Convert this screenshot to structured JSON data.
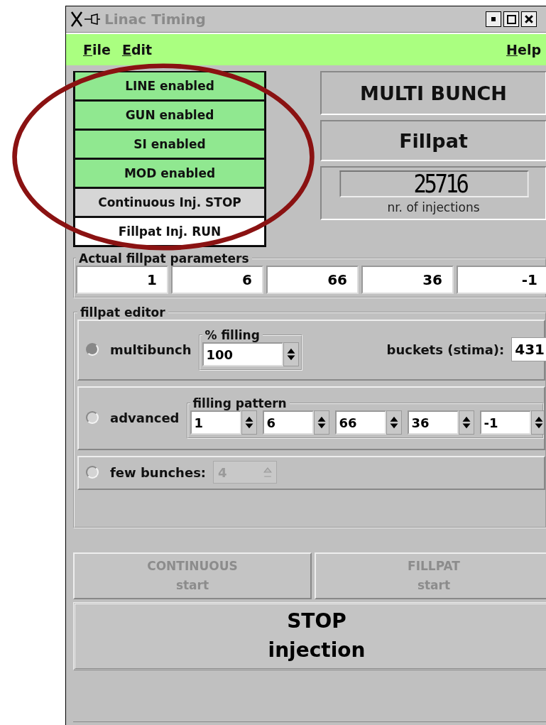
{
  "window": {
    "title": "Linac Timing"
  },
  "menu": {
    "left": [
      {
        "label": "File"
      },
      {
        "label": "Edit"
      }
    ],
    "right": [
      {
        "label": "Help"
      }
    ]
  },
  "status_buttons": [
    {
      "label": "LINE enabled",
      "kind": "enabled"
    },
    {
      "label": "GUN enabled",
      "kind": "enabled"
    },
    {
      "label": "SI enabled",
      "kind": "enabled"
    },
    {
      "label": "MOD enabled",
      "kind": "enabled"
    },
    {
      "label": "Continuous Inj. STOP",
      "kind": "stopped"
    },
    {
      "label": "Fillpat Inj. RUN",
      "kind": "running"
    }
  ],
  "mode": "MULTI BUNCH",
  "fill_mode": "Fillpat",
  "counter": {
    "value": "25716",
    "label": "nr. of injections"
  },
  "actual_parameters": {
    "title": "Actual fillpat parameters",
    "values": [
      "1",
      "6",
      "66",
      "36",
      "-1"
    ]
  },
  "editor": {
    "title": "fillpat editor",
    "options": [
      {
        "kind": "multibunch",
        "label": "multibunch",
        "selected": true,
        "group_title": "% filling",
        "value": "100",
        "buckets_label": "buckets (stima):",
        "buckets_value": "431"
      },
      {
        "kind": "advanced",
        "label": "advanced",
        "selected": false,
        "group_title": "filling pattern",
        "values": [
          "1",
          "6",
          "66",
          "36",
          "-1"
        ]
      },
      {
        "kind": "few",
        "label": "few bunches:",
        "selected": false,
        "value": "4",
        "disabled": true
      }
    ]
  },
  "buttons": [
    {
      "title": "CONTINUOUS",
      "subtitle": "start",
      "disabled": true
    },
    {
      "title": "FILLPAT",
      "subtitle": "start",
      "disabled": true
    }
  ],
  "stop_button": {
    "title": "STOP",
    "subtitle": "injection"
  }
}
